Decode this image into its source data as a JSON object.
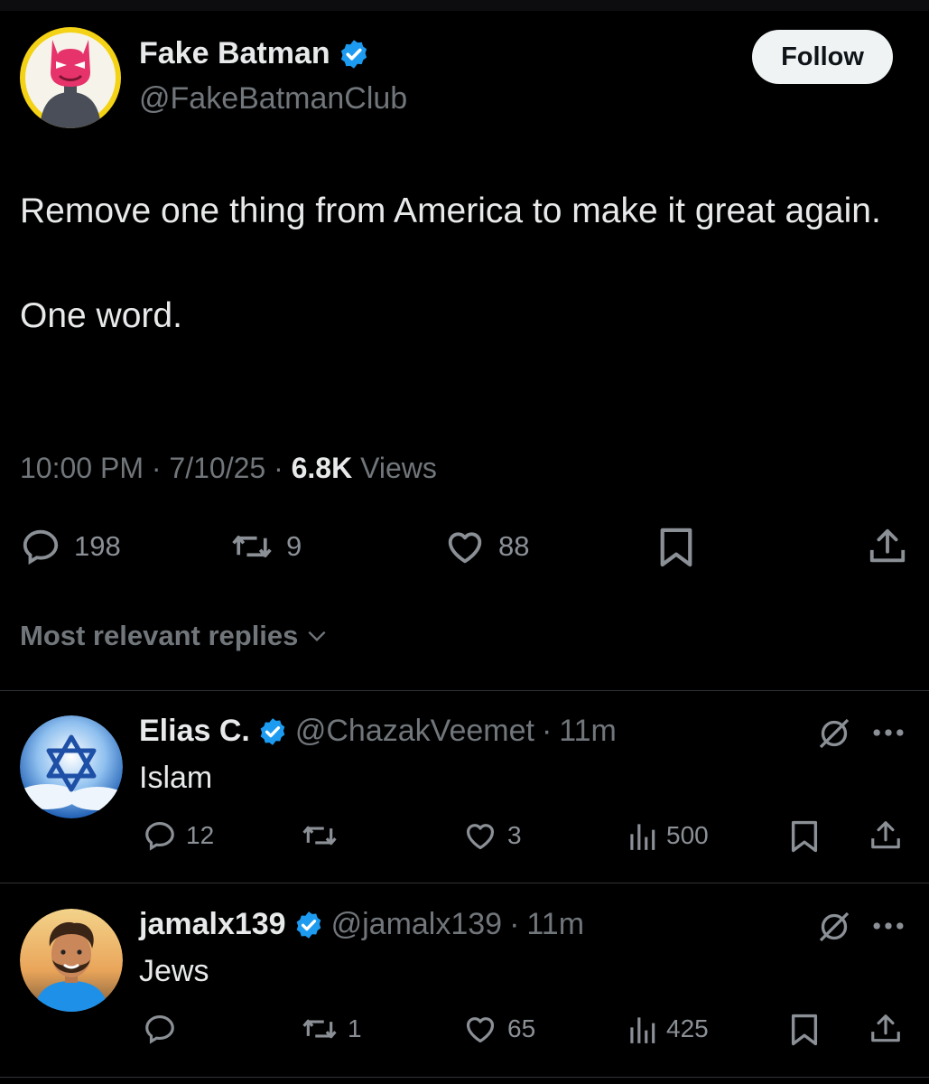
{
  "colors": {
    "background": "#000000",
    "text": "#e7e9ea",
    "muted": "#71767b",
    "verified": "#1d9bf0",
    "follow_bg": "#eff3f4"
  },
  "tweet": {
    "author_name": "Fake Batman",
    "author_handle": "@FakeBatmanClub",
    "follow_label": "Follow",
    "text_line1": "Remove one thing from America to make it great again.",
    "text_line2": "One word.",
    "time": "10:00 PM",
    "date": "7/10/25",
    "views_count": "6.8K",
    "views_label": "Views",
    "stats": {
      "replies": "198",
      "reposts": "9",
      "likes": "88"
    },
    "icons": [
      "reply-icon",
      "repost-icon",
      "heart-icon",
      "bookmark-icon",
      "share-icon"
    ]
  },
  "replies_header": "Most relevant replies",
  "replies": [
    {
      "name": "Elias C.",
      "handle": "@ChazakVeemet",
      "time": "11m",
      "text": "Islam",
      "stats": {
        "replies": "12",
        "reposts": "",
        "likes": "3",
        "views": "500"
      }
    },
    {
      "name": "jamalx139",
      "handle": "@jamalx139",
      "time": "11m",
      "text": "Jews",
      "stats": {
        "replies": "",
        "reposts": "1",
        "likes": "65",
        "views": "425"
      }
    }
  ]
}
